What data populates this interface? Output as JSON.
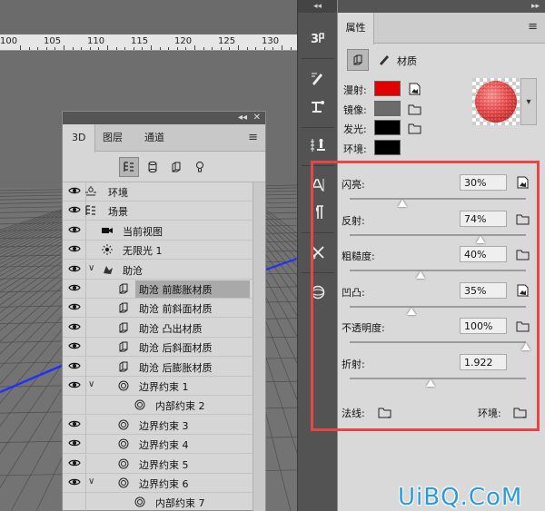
{
  "ruler": {
    "ticks": [
      "100",
      "105",
      "110",
      "115",
      "120",
      "125",
      "130"
    ]
  },
  "panel3d": {
    "collapse_glyph": "◂◂",
    "close_glyph": "✕",
    "tabs": [
      "3D",
      "图层",
      "通道"
    ],
    "menu_glyph": "≡",
    "tree": [
      {
        "label": "环境",
        "icon": "environment-icon",
        "visible": true
      },
      {
        "label": "场景",
        "icon": "scene-icon",
        "visible": true
      },
      {
        "label": "当前视图",
        "icon": "camera-icon",
        "visible": true
      },
      {
        "label": "无限光 1",
        "icon": "light-icon",
        "visible": true
      },
      {
        "label": "助沧",
        "icon": "mesh-icon",
        "visible": true,
        "expanded": true
      },
      {
        "label": "助沧 前膨胀材质",
        "icon": "material-icon",
        "visible": true,
        "selected": true
      },
      {
        "label": "助沧 前斜面材质",
        "icon": "material-icon",
        "visible": true
      },
      {
        "label": "助沧 凸出材质",
        "icon": "material-icon",
        "visible": true
      },
      {
        "label": "助沧 后斜面材质",
        "icon": "material-icon",
        "visible": true
      },
      {
        "label": "助沧 后膨胀材质",
        "icon": "material-icon",
        "visible": true
      },
      {
        "label": "边界约束 1",
        "icon": "constraint-icon",
        "visible": true,
        "expanded": true
      },
      {
        "label": "内部约束 2",
        "icon": "constraint-icon",
        "visible": false
      },
      {
        "label": "边界约束 3",
        "icon": "constraint-icon",
        "visible": true
      },
      {
        "label": "边界约束 4",
        "icon": "constraint-icon",
        "visible": true
      },
      {
        "label": "边界约束 5",
        "icon": "constraint-icon",
        "visible": true
      },
      {
        "label": "边界约束 6",
        "icon": "constraint-icon",
        "visible": true,
        "expanded": true
      },
      {
        "label": "内部约束 7",
        "icon": "constraint-icon",
        "visible": false
      }
    ]
  },
  "dock": {
    "collapse_glyph": "◂◂"
  },
  "properties": {
    "collapse_glyph": "▸▸",
    "tab": "属性",
    "menu_glyph": "≡",
    "mode_label": "材质",
    "colors": [
      {
        "label": "漫射:",
        "color": "#e00000",
        "map": "texture-icon"
      },
      {
        "label": "镜像:",
        "color": "#6b6b6b",
        "map": "folder-icon"
      },
      {
        "label": "发光:",
        "color": "#000000",
        "map": "folder-icon"
      },
      {
        "label": "环境:",
        "color": "#000000",
        "map": ""
      }
    ],
    "sliders": [
      {
        "label": "闪亮:",
        "value": "30%",
        "level": 0.3,
        "map": "texture-icon"
      },
      {
        "label": "反射:",
        "value": "74%",
        "level": 0.74,
        "map": "folder-icon"
      },
      {
        "label": "粗糙度:",
        "value": "40%",
        "level": 0.4,
        "map": "folder-icon"
      },
      {
        "label": "凹凸:",
        "value": "35%",
        "level": 0.35,
        "map": "texture-icon"
      },
      {
        "label": "不透明度:",
        "value": "100%",
        "level": 1.0,
        "map": "folder-icon"
      },
      {
        "label": "折射:",
        "value": "1.922",
        "level": 0.46,
        "map": ""
      }
    ],
    "normal_label": "法线:",
    "environment_label": "环境:"
  },
  "watermark": "UiBQ.CoM"
}
